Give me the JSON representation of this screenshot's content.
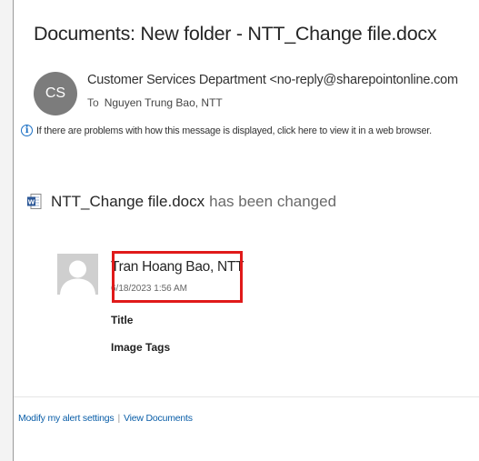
{
  "email": {
    "subject": "Documents: New folder - NTT_Change file.docx",
    "sender_initials": "CS",
    "sender": "Customer Services Department <no-reply@sharepointonline.com",
    "to_label": "To",
    "to": "Nguyen Trung Bao, NTT",
    "info_text": "If there are problems with how this message is displayed, click here to view it in a web browser."
  },
  "body": {
    "file_name": "NTT_Change file.docx",
    "change_text": "has been changed",
    "editor_name": "Tran Hoang Bao, NTT",
    "edit_date": "6/18/2023 1:56 AM",
    "field_title": "Title",
    "field_tags": "Image Tags"
  },
  "footer": {
    "modify_alert": "Modify my alert settings",
    "separator": "|",
    "view_documents": "View Documents"
  },
  "colors": {
    "highlight": "#e01a1a",
    "link": "#0a5ea8",
    "info_icon": "#1a6fc4",
    "word_icon": "#2b5797"
  },
  "icons": {
    "info": "info-icon",
    "document": "word-document-icon",
    "person": "person-placeholder-icon"
  }
}
